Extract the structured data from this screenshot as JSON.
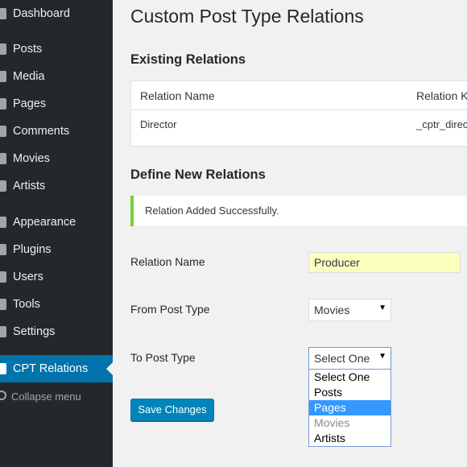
{
  "sidebar": {
    "items": [
      {
        "label": "Dashboard",
        "icon": "dashboard-icon"
      },
      {
        "label": "Posts",
        "icon": "pin-icon"
      },
      {
        "label": "Media",
        "icon": "media-icon"
      },
      {
        "label": "Pages",
        "icon": "page-icon"
      },
      {
        "label": "Comments",
        "icon": "comment-icon"
      },
      {
        "label": "Movies",
        "icon": "pin-icon"
      },
      {
        "label": "Artists",
        "icon": "pin-icon"
      },
      {
        "label": "Appearance",
        "icon": "brush-icon"
      },
      {
        "label": "Plugins",
        "icon": "plugin-icon"
      },
      {
        "label": "Users",
        "icon": "users-icon"
      },
      {
        "label": "Tools",
        "icon": "wrench-icon"
      },
      {
        "label": "Settings",
        "icon": "settings-icon"
      },
      {
        "label": "CPT Relations",
        "icon": "settings-icon",
        "active": true
      }
    ],
    "collapse_label": "Collapse menu"
  },
  "page": {
    "title": "Custom Post Type Relations"
  },
  "existing": {
    "heading": "Existing Relations",
    "columns": [
      "Relation Name",
      "Relation K"
    ],
    "rows": [
      [
        "Director",
        "_cptr_direc"
      ]
    ]
  },
  "define": {
    "heading": "Define New Relations",
    "notice": "Relation Added Successfully.",
    "relation_name_label": "Relation Name",
    "relation_name_value": "Producer",
    "from_label": "From Post Type",
    "from_value": "Movies",
    "to_label": "To Post Type",
    "to_value": "Select One",
    "to_options": [
      {
        "label": "Select One"
      },
      {
        "label": "Posts"
      },
      {
        "label": "Pages",
        "selected": true
      },
      {
        "label": "Movies",
        "disabled": true
      },
      {
        "label": "Artists"
      }
    ],
    "save_label": "Save Changes"
  },
  "colors": {
    "sidebar_bg": "#23282d",
    "active_bg": "#0073aa",
    "notice_border": "#7ad03a",
    "button_bg": "#0085ba",
    "option_highlight": "#3399ff"
  }
}
